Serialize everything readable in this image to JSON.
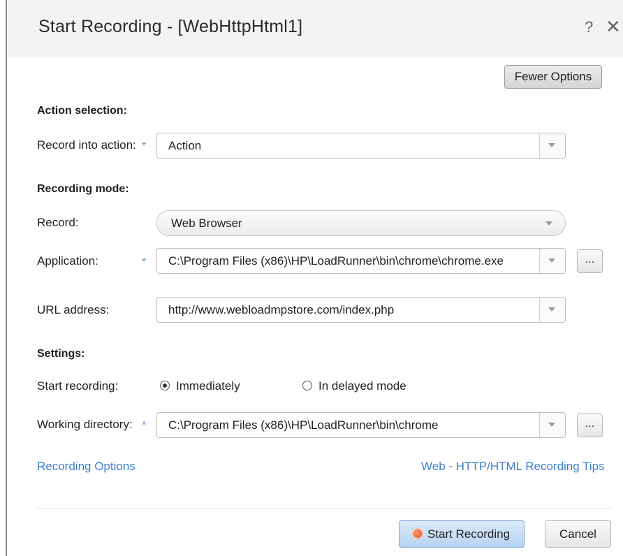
{
  "dialog": {
    "title": "Start Recording - [WebHttpHtml1]",
    "help_glyph": "?",
    "close_glyph": "✕"
  },
  "toolbar": {
    "fewer_options_label": "Fewer Options"
  },
  "action_section": {
    "heading": "Action selection:",
    "record_into_label": "Record into action:",
    "record_into_value": "Action"
  },
  "recording_mode": {
    "heading": "Recording mode:",
    "record_label": "Record:",
    "record_value": "Web Browser",
    "application_label": "Application:",
    "application_value": "C:\\Program Files (x86)\\HP\\LoadRunner\\bin\\chrome\\chrome.exe",
    "url_label": "URL address:",
    "url_value": "http://www.webloadmpstore.com/index.php"
  },
  "settings": {
    "heading": "Settings:",
    "start_recording_label": "Start recording:",
    "option_immediately": "Immediately",
    "option_delayed": "In delayed mode",
    "selected_option": "Immediately",
    "working_dir_label": "Working directory:",
    "working_dir_value": "C:\\Program Files (x86)\\HP\\LoadRunner\\bin\\chrome"
  },
  "links": {
    "recording_options": "Recording Options",
    "recording_tips": "Web - HTTP/HTML Recording Tips"
  },
  "footer": {
    "start_label": "Start Recording",
    "cancel_label": "Cancel"
  },
  "misc": {
    "required_mark": "*",
    "browse_label": "...",
    "link_color": "#3f7fd0",
    "required_color": "#5b9bd5"
  }
}
